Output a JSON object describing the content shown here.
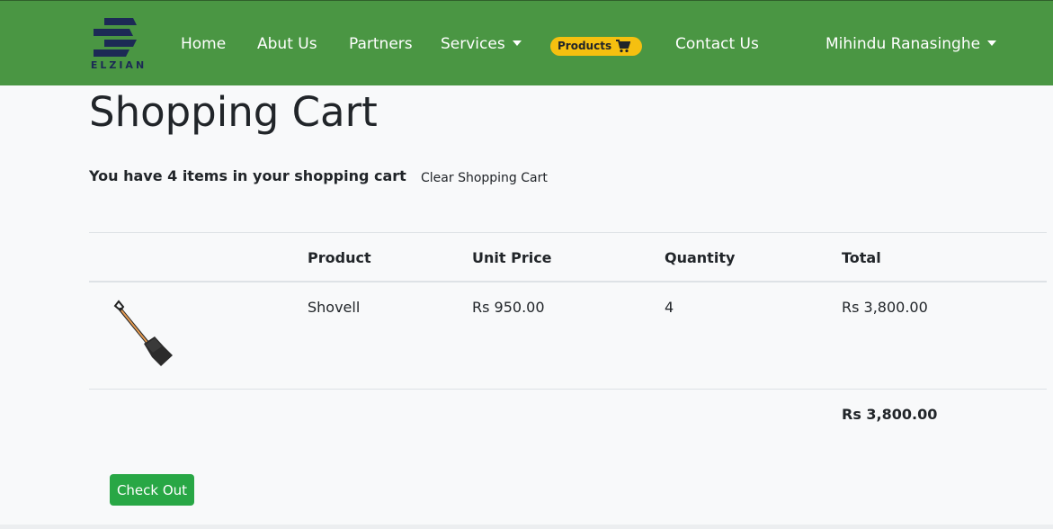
{
  "nav": {
    "logo_text": "ELZIAN",
    "items": [
      {
        "label": "Home"
      },
      {
        "label": "Abut Us"
      },
      {
        "label": "Partners"
      },
      {
        "label": "Services"
      }
    ],
    "products_label": "Products",
    "contact_label": "Contact Us",
    "user_name": "Mihindu Ranasinghe",
    "brand_color": "#4a9643",
    "badge_color": "#f5c010"
  },
  "page": {
    "title": "Shopping Cart",
    "summary": "You have 4 items in your shopping cart",
    "clear_label": "Clear Shopping Cart"
  },
  "table": {
    "headers": [
      "Product",
      "Unit Price",
      "Quantity",
      "Total"
    ],
    "rows": [
      {
        "image_icon": "shovel-icon",
        "product": "Shovell",
        "unit_price": "Rs 950.00",
        "quantity": "4",
        "total": "Rs 3,800.00"
      }
    ],
    "grand_total": "Rs 3,800.00"
  },
  "checkout_label": "Check Out",
  "checkout_color": "#28a745"
}
